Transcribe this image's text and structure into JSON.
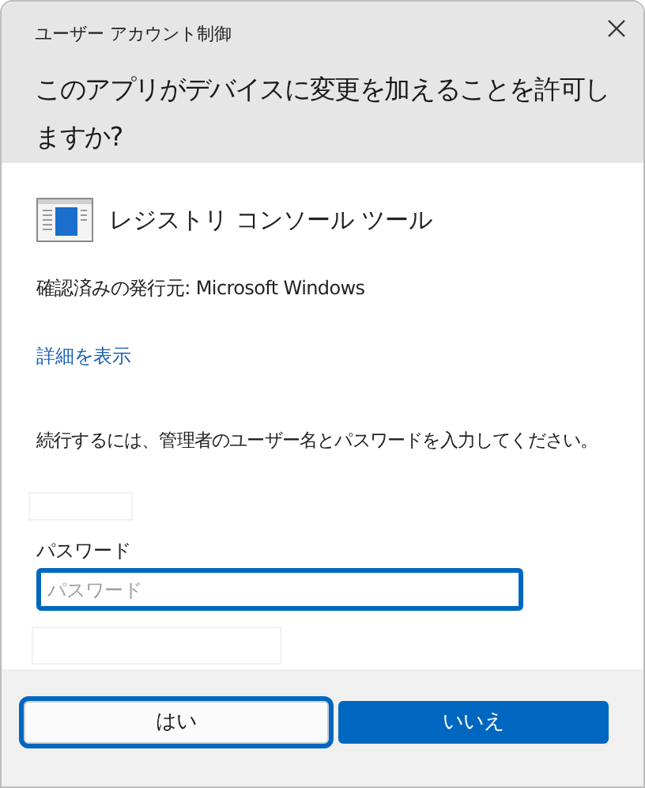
{
  "window": {
    "title": "ユーザー アカウント制御"
  },
  "question": "このアプリがデバイスに変更を加えることを許可しますか?",
  "app": {
    "name": "レジストリ コンソール ツール"
  },
  "publisher": "確認済みの発行元: Microsoft Windows",
  "details_link": "詳細を表示",
  "instruction": "続行するには、管理者のユーザー名とパスワードを入力してください。",
  "password": {
    "label": "パスワード",
    "placeholder": "パスワード",
    "focused": true
  },
  "buttons": [
    {
      "label": "はい",
      "kind": "secondary",
      "focused": true
    },
    {
      "label": "いいえ",
      "kind": "primary",
      "focused": false
    }
  ]
}
